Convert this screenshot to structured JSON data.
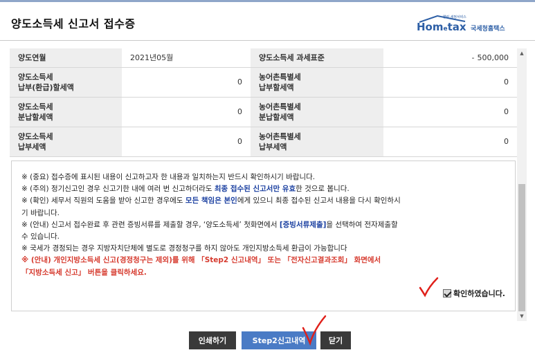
{
  "window": {
    "title": "양도소득세 신고서 접수증"
  },
  "logo": {
    "brand_home": "Hom",
    "brand_e": "e",
    "brand_tax": "tax",
    "tagline": "열린 세정서비스",
    "korean_name": "국세청홈택스"
  },
  "summary": {
    "row1": {
      "label_left": "양도연월",
      "value_left": "2021년05월",
      "label_right": "양도소득세 과세표준",
      "value_right_prefix": "-",
      "value_right": "500,000"
    },
    "row2": {
      "label_left_1": "양도소득세",
      "label_left_2": "납부(환급)할세액",
      "value_left": "0",
      "label_right_1": "농어촌특별세",
      "label_right_2": "납부할세액",
      "value_right": "0"
    },
    "row3": {
      "label_left_1": "양도소득세",
      "label_left_2": "분납할세액",
      "value_left": "0",
      "label_right_1": "농어촌특별세",
      "label_right_2": "분납할세액",
      "value_right": "0"
    },
    "row4": {
      "label_left_1": "양도소득세",
      "label_left_2": "납부세액",
      "value_left": "0",
      "label_right_1": "농어촌특별세",
      "label_right_2": "납부세액",
      "value_right": "0"
    }
  },
  "notice": {
    "line1": "※ (중요) 접수증에 표시된 내용이 신고하고자 한 내용과 일치하는지 반드시 확인하시기 바랍니다.",
    "line2_a": "※ (주의) 정기신고인 경우 신고기한 내에 여러 번 신고하더라도 ",
    "line2_b": "최종 접수된 신고서만 유효",
    "line2_c": "한 것으로 봅니다.",
    "line3_a": "※ (확인) 세무서 직원의 도움을 받아 신고한 경우에도 ",
    "line3_b": "모든 책임은 본인",
    "line3_c": "에게 있으니 최종 접수된 신고서 내용을 다시 확인하시",
    "line3_d": "기 바랍니다.",
    "line4_a": "※ (안내) 신고서 접수완료 후 관련 증빙서류를 제출할 경우, ‘양도소득세’ 첫화면에서 ",
    "line4_b": "[증빙서류제출]",
    "line4_c": "을 선택하여 전자제출할",
    "line4_d": "수 있습니다.",
    "line5": "※ 국세가 경정되는 경우 지방자치단체에 별도로 경정청구를 하지 않아도 개인지방소득세 환급이 가능합니다",
    "line6": "※ (안내) 개인지방소득세 신고(경정청구는 제외)를 위해 「Step2 신고내역」 또는 「전자신고결과조회」 화면에서",
    "line7": "「지방소득세 신고」 버튼을 클릭하세요.",
    "confirm_label": "확인하였습니다.",
    "confirm_checked": true
  },
  "buttons": {
    "print": "인쇄하기",
    "step2": "Step2신고내역",
    "close": "닫기"
  },
  "colors": {
    "button_dark": "#3a3a3a",
    "button_blue": "#4a7bc5",
    "emphasis_blue": "#1a3fa0",
    "emphasis_red": "#d63a2e",
    "annotation_red": "#e0201a",
    "brand_blue": "#2d5fa6"
  },
  "icons": {
    "scroll_up": "scroll-up-arrow-icon",
    "scroll_down": "scroll-down-arrow-icon",
    "annotation": "handwritten-checkmark-icon"
  }
}
